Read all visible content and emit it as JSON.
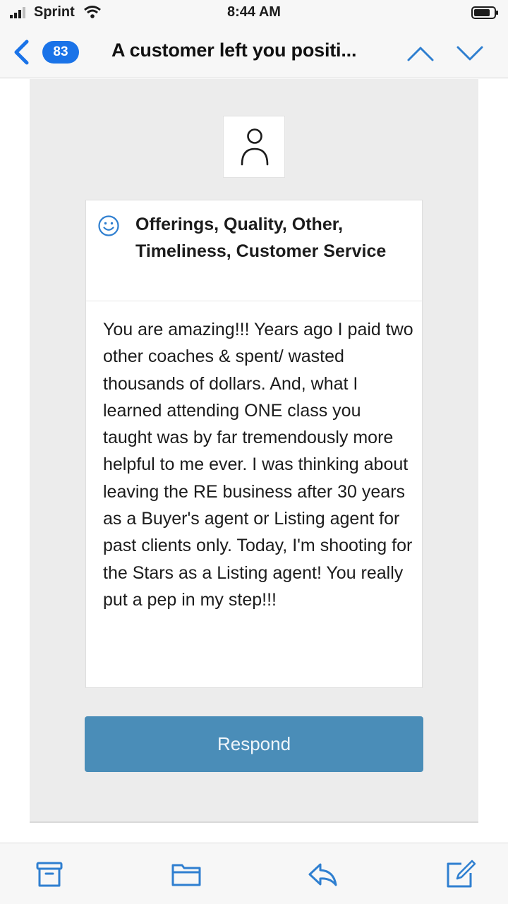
{
  "status_bar": {
    "carrier": "Sprint",
    "time": "8:44 AM"
  },
  "nav": {
    "unread_count": "83",
    "title": "A customer left you positi..."
  },
  "review": {
    "categories": "Offerings, Quality, Other, Timeliness, Customer Service",
    "text": "You are amazing!!! Years ago I paid two other coaches & spent/ wasted thousands of dollars. And, what I learned attending ONE class you taught was by far tremendously more helpful to me ever. I was thinking about leaving the RE business after 30 years as a Buyer's agent or Listing agent for past clients only. Today, I'm shooting for the Stars as a Listing agent! You really put a pep in my step!!!"
  },
  "actions": {
    "respond_label": "Respond"
  },
  "colors": {
    "accent": "#1a73e8",
    "respond_button": "#4a8db8",
    "icon_blue": "#2f7fd0"
  }
}
